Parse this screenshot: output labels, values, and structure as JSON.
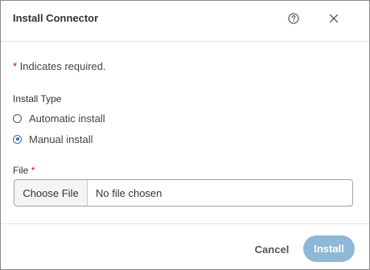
{
  "dialog": {
    "title": "Install Connector",
    "help_icon": "help-circle-icon",
    "close_icon": "close-icon"
  },
  "form": {
    "required_asterisk": "*",
    "required_note": " Indicates required.",
    "install_type": {
      "label": "Install Type",
      "options": [
        {
          "label": "Automatic install",
          "checked": false
        },
        {
          "label": "Manual install",
          "checked": true
        }
      ]
    },
    "file": {
      "label": "File",
      "required_asterisk": "*",
      "button_label": "Choose File",
      "status": "No file chosen"
    }
  },
  "footer": {
    "cancel_label": "Cancel",
    "install_label": "Install",
    "install_enabled": false
  },
  "colors": {
    "accent": "#2b6cb0",
    "install_disabled": "#8fb7d6",
    "required": "#d0021b"
  }
}
